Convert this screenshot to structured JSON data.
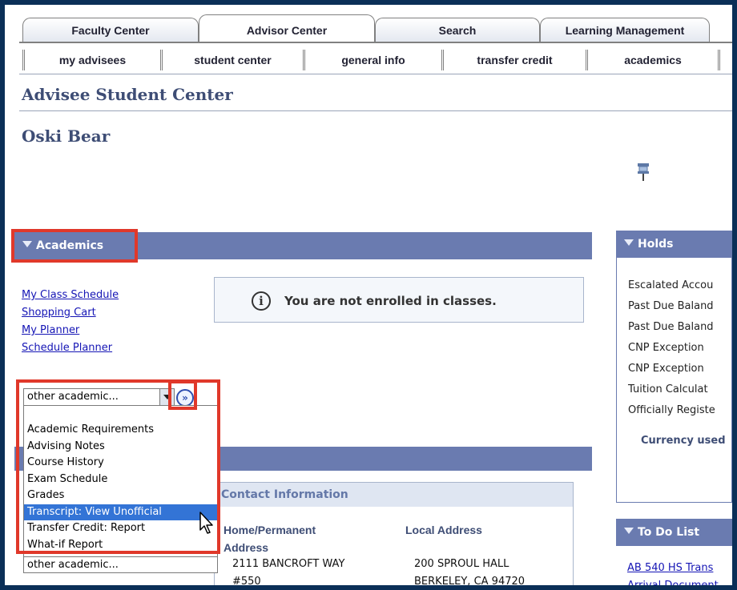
{
  "tabs": [
    "Faculty Center",
    "Advisor Center",
    "Search",
    "Learning Management"
  ],
  "subtabs": [
    "my advisees",
    "student center",
    "general info",
    "transfer credit",
    "academics"
  ],
  "page_title": "Advisee Student Center",
  "student_name": "Oski Bear",
  "academics": {
    "header": "Academics",
    "links": [
      "My Class Schedule",
      "Shopping Cart",
      "My Planner",
      "Schedule Planner"
    ],
    "notice": "You are not enrolled in classes.",
    "select_value": "other academic...",
    "go_glyph": "»",
    "options": [
      "Academic Requirements",
      "Advising Notes",
      "Course History",
      "Exam Schedule",
      "Grades",
      "Transcript: View Unofficial",
      "Transfer Credit: Report",
      "What-if Report"
    ],
    "selected_option": "Transcript: View Unofficial",
    "dropdown_footer": "other academic..."
  },
  "contact": {
    "header": "Contact Information",
    "home_label_1": "Home/Permanent",
    "home_label_2": "Address",
    "local_label": "Local Address",
    "home_line1": "2111 BANCROFT WAY",
    "home_line2": "#550",
    "local_line1": "200 SPROUL HALL",
    "local_line2": "BERKELEY, CA 94720"
  },
  "holds": {
    "header": "Holds",
    "items": [
      "Escalated Accou",
      "Past Due Baland",
      "Past Due Baland",
      "CNP Exception",
      "CNP Exception",
      "Tuition Calculat",
      "Officially Registe"
    ],
    "currency": "Currency used"
  },
  "todo": {
    "header": "To Do List",
    "links": [
      "AB 540 HS Trans",
      "Arrival Document"
    ]
  },
  "colors": {
    "header_bar": "#6a7bb0",
    "highlight": "#e0382a",
    "selection": "#3374d6",
    "link": "#1515b5"
  }
}
